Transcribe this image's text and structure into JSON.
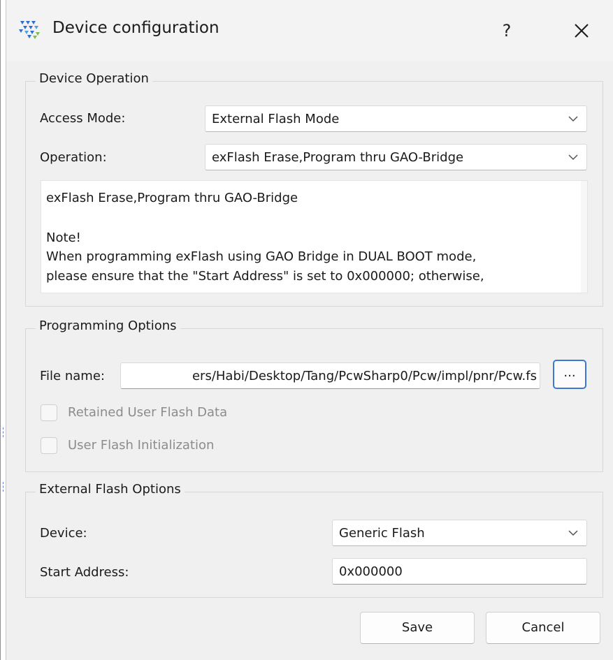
{
  "window": {
    "title": "Device configuration",
    "help_label": "?"
  },
  "device_operation": {
    "group_title": "Device Operation",
    "access_mode_label": "Access Mode:",
    "access_mode_value": "External Flash Mode",
    "operation_label": "Operation:",
    "operation_value": "exFlash Erase,Program thru GAO-Bridge",
    "description": {
      "line1": "exFlash Erase,Program thru GAO-Bridge",
      "line2": "Note!",
      "line3": "When programming exFlash using GAO Bridge in DUAL BOOT mode,",
      "line4": "please ensure that the \"Start Address\" is set to 0x000000; otherwise,"
    }
  },
  "programming_options": {
    "group_title": "Programming Options",
    "file_name_label": "File name:",
    "file_name_value": "ers/Habi/Desktop/Tang/PcwSharp0/Pcw/impl/pnr/Pcw.fs",
    "browse_label": "...",
    "retained_user_flash_label": "Retained User Flash Data",
    "user_flash_init_label": "User Flash Initialization"
  },
  "external_flash_options": {
    "group_title": "External Flash Options",
    "device_label": "Device:",
    "device_value": "Generic Flash",
    "start_address_label": "Start Address:",
    "start_address_value": "0x000000"
  },
  "buttons": {
    "save": "Save",
    "cancel": "Cancel"
  },
  "colors": {
    "accent": "#3b78d4",
    "background": "#f0f0f0",
    "disabled_text": "#8c8c8c"
  },
  "icons": {
    "app": "gowin-logo-icon",
    "close": "close-icon",
    "dropdown": "chevron-down-icon"
  }
}
